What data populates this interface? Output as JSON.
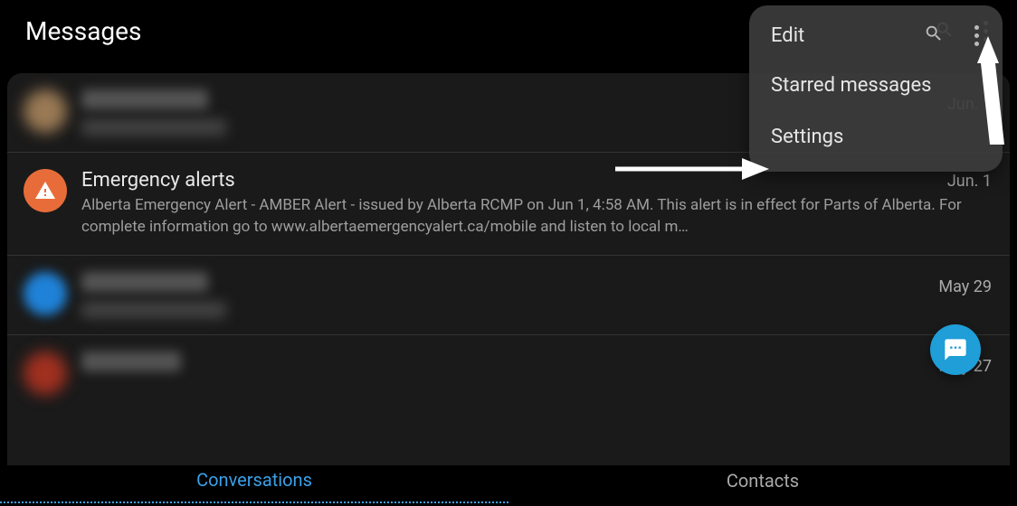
{
  "header": {
    "title": "Messages"
  },
  "menu": {
    "edit": "Edit",
    "starred": "Starred messages",
    "settings": "Settings"
  },
  "threads": [
    {
      "title_hidden": true,
      "date": "Jun. 1",
      "avatar_color": "#9a7a55"
    },
    {
      "title": "Emergency alerts",
      "date": "Jun. 1",
      "preview": "Alberta Emergency Alert - AMBER Alert - issued by Alberta RCMP on Jun 1, 4:58 AM. This alert is in effect for Parts of Alberta. For complete information go to www.albertaemergencyalert.ca/mobile and listen to local m…",
      "icon": "warning-triangle"
    },
    {
      "title_hidden": true,
      "date": "May 29",
      "avatar_color": "#1f82d8"
    },
    {
      "title_hidden": true,
      "date": "May 27",
      "avatar_color": "#a03020"
    }
  ],
  "nav": {
    "conversations": "Conversations",
    "contacts": "Contacts"
  }
}
